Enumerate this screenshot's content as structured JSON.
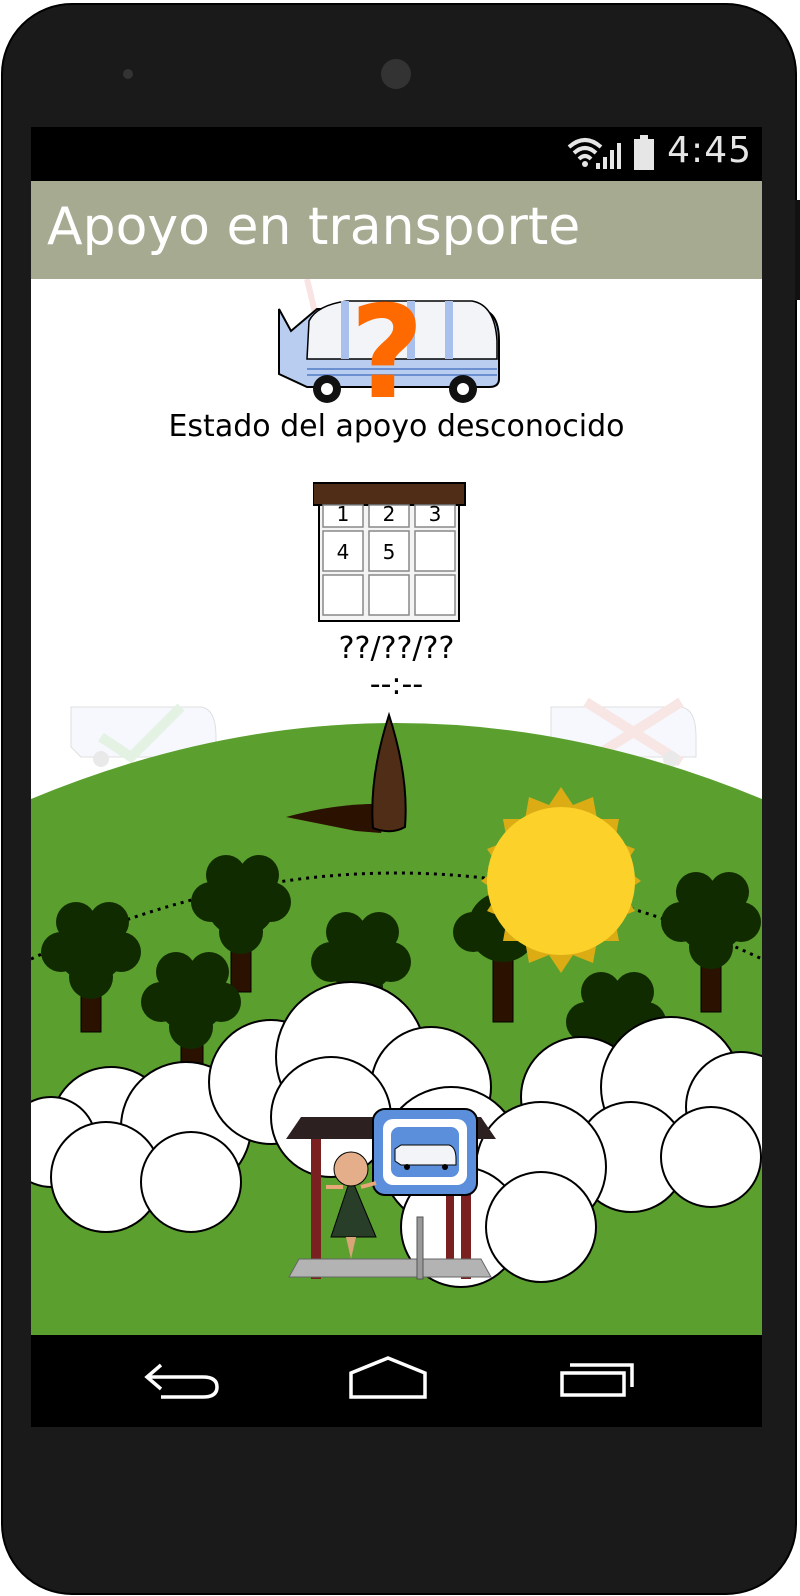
{
  "status_bar": {
    "time": "4:45",
    "icons": [
      "wifi-icon",
      "cellular-signal-icon",
      "battery-icon"
    ]
  },
  "app_bar": {
    "title": "Apoyo en transporte",
    "background": "#a6aa91"
  },
  "support_status": {
    "icon": "bus-unknown-status-icon",
    "marker": "?",
    "text": "Estado del apoyo desconocido"
  },
  "calendar": {
    "icon": "calendar-icon",
    "days": [
      "1",
      "2",
      "3",
      "4",
      "5"
    ],
    "date": "??/??/??",
    "time": "--:--"
  },
  "scene": {
    "description_icons": [
      "bus-confirmed-faded-icon",
      "bus-cancelled-faded-icon",
      "sundial-gnomon-icon",
      "sun-icon",
      "tree-icon",
      "cloud-icon",
      "bus-stop-icon",
      "person-icon"
    ],
    "colors": {
      "grass": "#5ba02e",
      "sun": "#fcd12a",
      "sun_rays": "#dbac14",
      "stop_sign": "#5b8fdb"
    }
  },
  "nav_bar": {
    "buttons": [
      "back-button",
      "home-button",
      "recents-button"
    ]
  }
}
